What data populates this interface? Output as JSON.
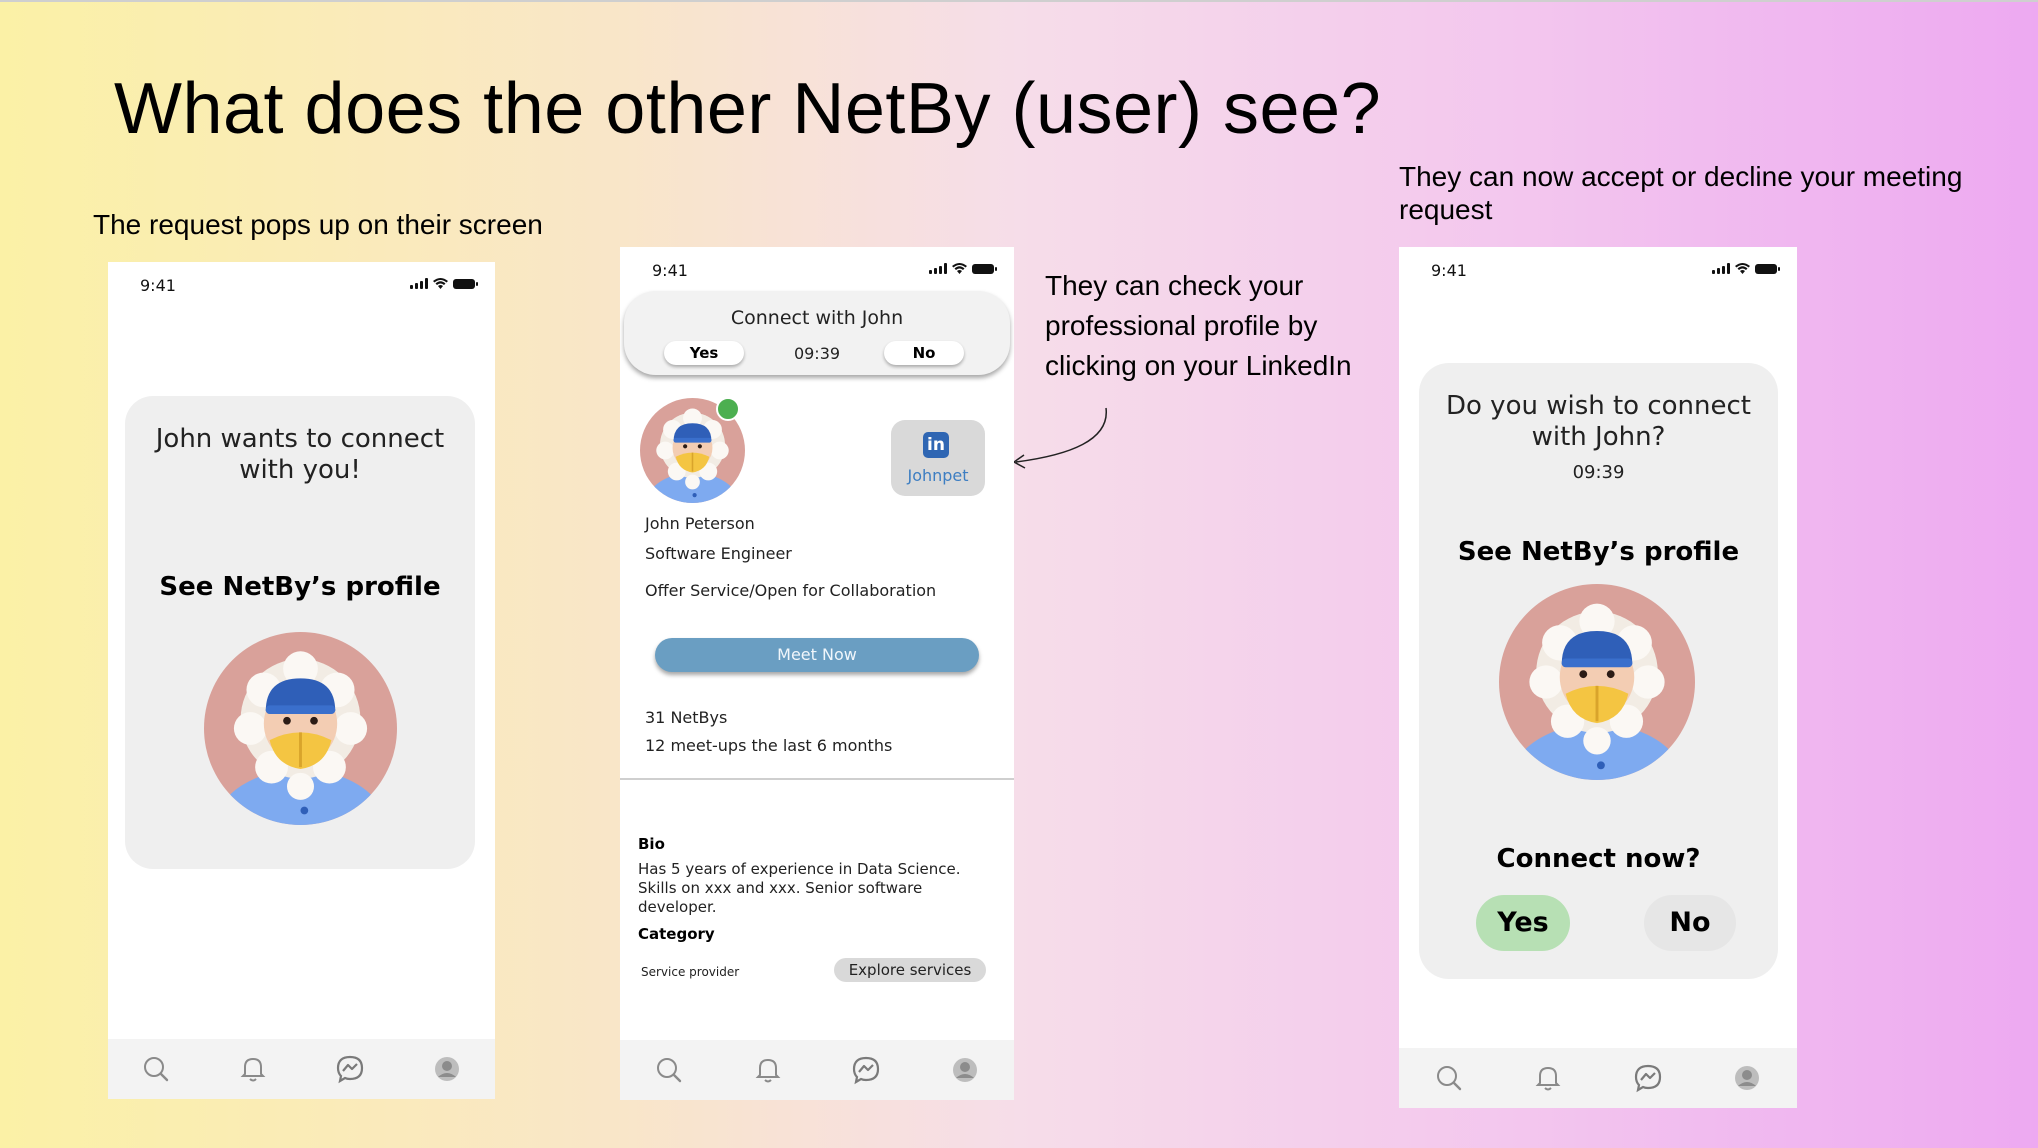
{
  "slide": {
    "title": "What does the other NetBy (user) see?",
    "caption_left": "The request pops up on their screen",
    "caption_middle": "They can check your professional profile by clicking on your LinkedIn",
    "caption_right": "They can now accept or decline your meeting request"
  },
  "status_bar": {
    "time": "9:41"
  },
  "tab_bar": {
    "icons": [
      "search-icon",
      "bell-icon",
      "messenger-icon",
      "profile-icon"
    ]
  },
  "screen1": {
    "message": "John wants to connect with you!",
    "see_profile": "See NetBy’s profile"
  },
  "screen2": {
    "banner": {
      "title": "Connect with John",
      "yes": "Yes",
      "time": "09:39",
      "no": "No"
    },
    "online_color": "#4caf50",
    "linkedin": {
      "logo": "in",
      "handle": "Johnpet"
    },
    "name": "John Peterson",
    "role": "Software Engineer",
    "offer": "Offer Service/Open for Collaboration",
    "meet_button": "Meet Now",
    "netbys": "31 NetBys",
    "meetups": "12 meet-ups the last 6 months",
    "bio_heading": "Bio",
    "bio": "Has 5 years of experience in Data Science. Skills on xxx and xxx. Senior software developer.",
    "category_heading": "Category",
    "category_value": "Service provider",
    "explore_button": "Explore services"
  },
  "screen3": {
    "question": "Do you wish to connect with John?",
    "time": "09:39",
    "see_profile": "See NetBy’s profile",
    "connect_now": "Connect now?",
    "yes": "Yes",
    "no": "No"
  }
}
